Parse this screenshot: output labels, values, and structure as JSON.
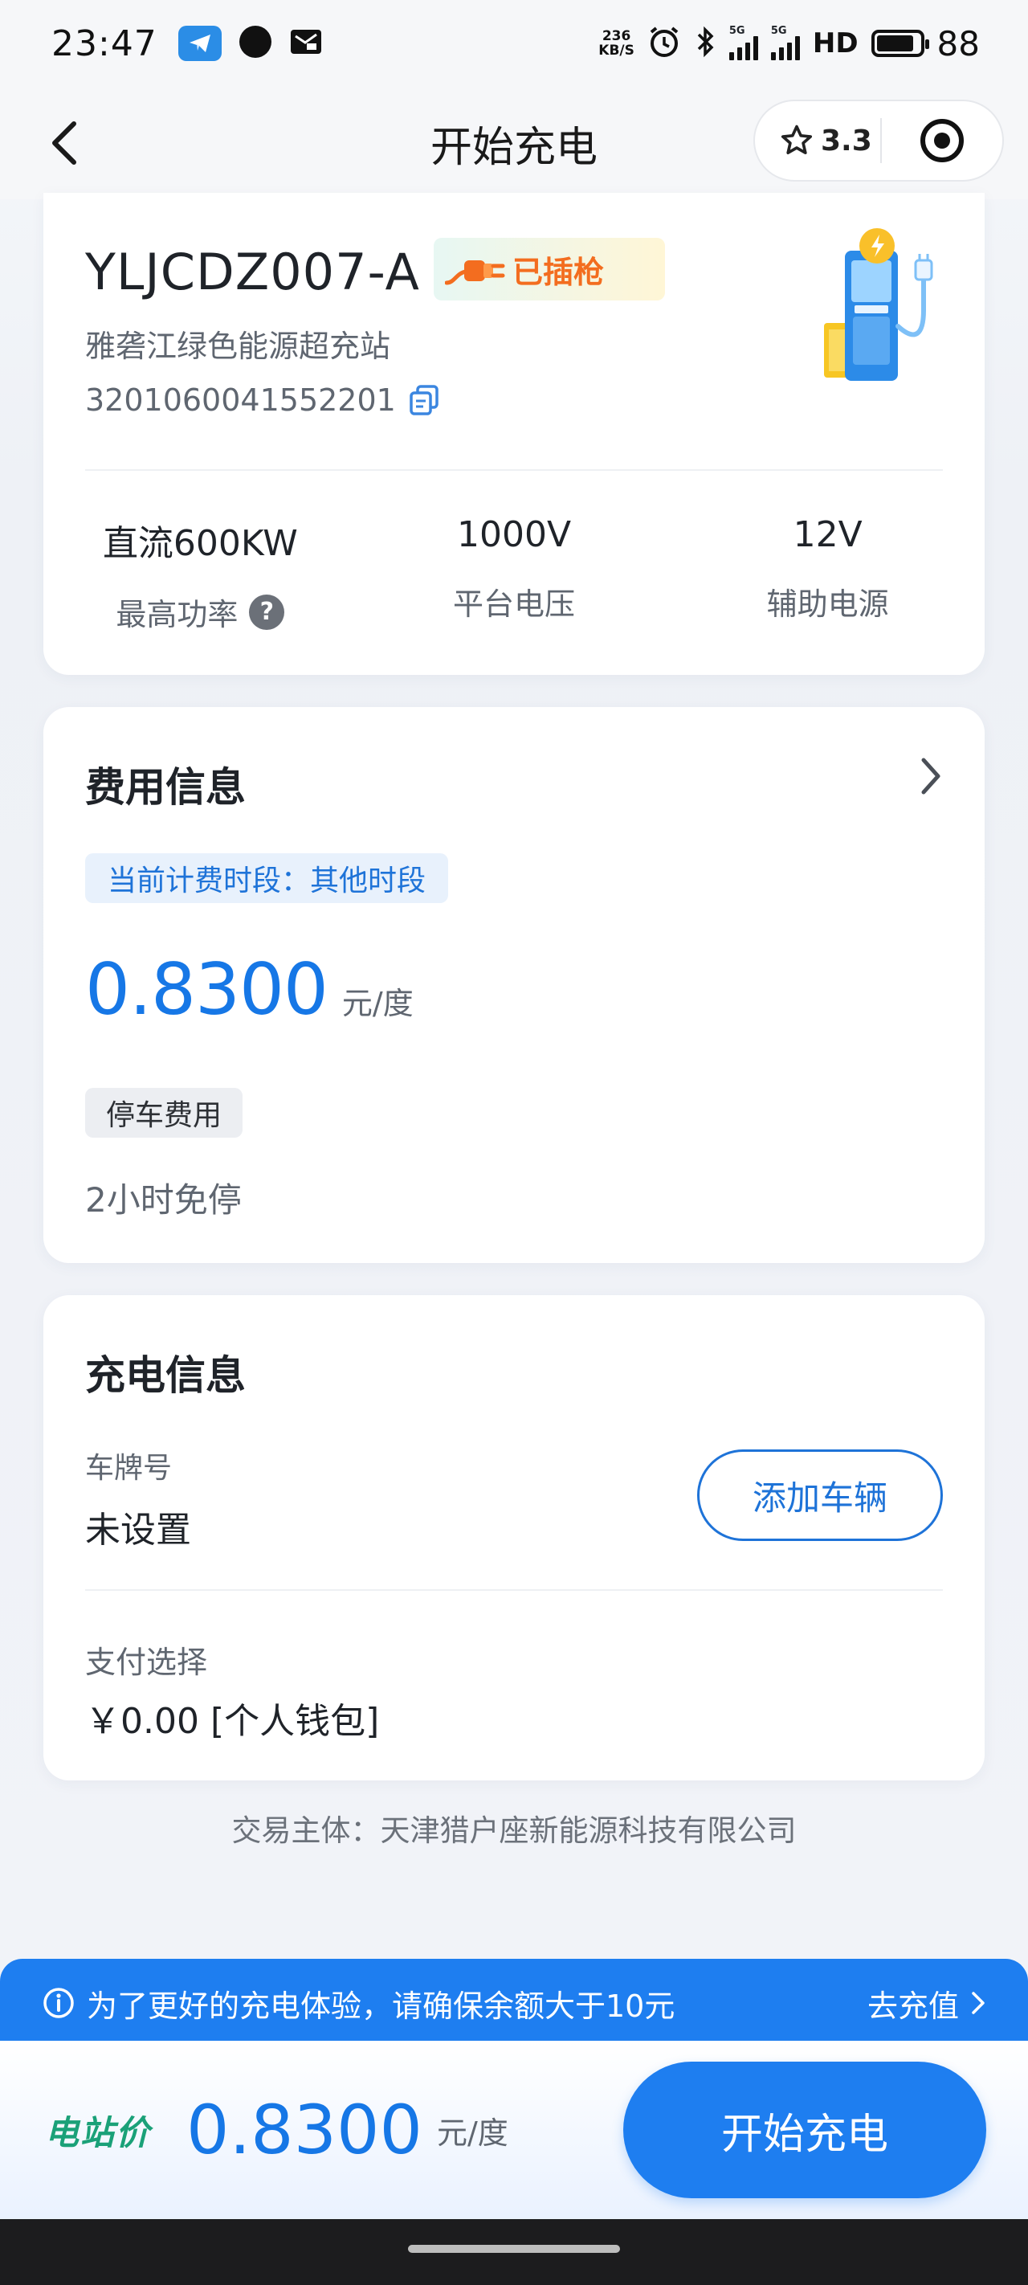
{
  "status_bar": {
    "time": "23:47",
    "net_speed_value": "236",
    "net_speed_unit": "KB/S",
    "sim1_label": "5G",
    "sim2_label": "5G",
    "hd_label": "HD",
    "battery_level": "88",
    "icons": [
      "telegram-icon",
      "circle-app-icon",
      "mail-box-icon",
      "alarm-icon",
      "bluetooth-icon",
      "signal-icon",
      "battery-icon"
    ]
  },
  "nav": {
    "title": "开始充电",
    "rating": "3.3",
    "icons": [
      "back-chevron-icon",
      "star-icon",
      "target-icon"
    ]
  },
  "pile": {
    "name": "YLJCDZ007-A",
    "status_badge": "已插枪",
    "station_name": "雅砻江绿色能源超充站",
    "serial_number": "3201060041552201",
    "specs": [
      {
        "value": "直流600KW",
        "label": "最高功率"
      },
      {
        "value": "1000V",
        "label": "平台电压"
      },
      {
        "value": "12V",
        "label": "辅助电源"
      }
    ],
    "help_glyph": "?"
  },
  "fee": {
    "title": "费用信息",
    "current_period": "当前计费时段：其他时段",
    "price": "0.8300",
    "unit": "元/度",
    "parking_tag": "停车费用",
    "parking_text": "2小时免停"
  },
  "charging": {
    "title": "充电信息",
    "plate_label": "车牌号",
    "plate_value": "未设置",
    "add_vehicle_label": "添加车辆",
    "payment_label": "支付选择",
    "payment_value": "￥0.00 [个人钱包]"
  },
  "trade_entity": "交易主体：天津猎户座新能源科技有限公司",
  "notice": {
    "text": "为了更好的充电体验，请确保余额大于10元",
    "action": "去充值"
  },
  "bottom": {
    "station_price_label": "电站价",
    "price": "0.8300",
    "unit": "元/度",
    "start_button": "开始充电"
  },
  "colors": {
    "accent": "#1e7ef0",
    "price_blue": "#1677e6",
    "badge_orange": "#f36d1f",
    "station_green": "#1aa178"
  }
}
